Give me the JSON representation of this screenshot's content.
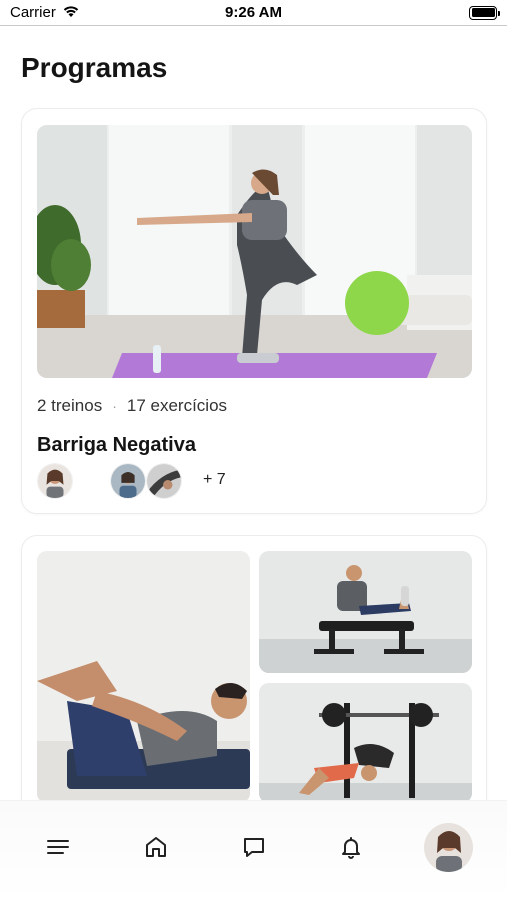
{
  "status_bar": {
    "carrier": "Carrier",
    "time": "9:26 AM"
  },
  "page": {
    "title": "Programas"
  },
  "programs": [
    {
      "title": "Barriga Negativa",
      "workouts": "2 treinos",
      "separator": "·",
      "exercises": "17 exercícios",
      "extra_participants": "+ 7"
    }
  ],
  "nav": {
    "items": [
      "menu-icon",
      "home-icon",
      "chat-icon",
      "bell-icon",
      "profile-avatar"
    ]
  },
  "colors": {
    "accent_mat": "#b27ad6",
    "ball": "#8ed64a",
    "background": "#ffffff"
  }
}
